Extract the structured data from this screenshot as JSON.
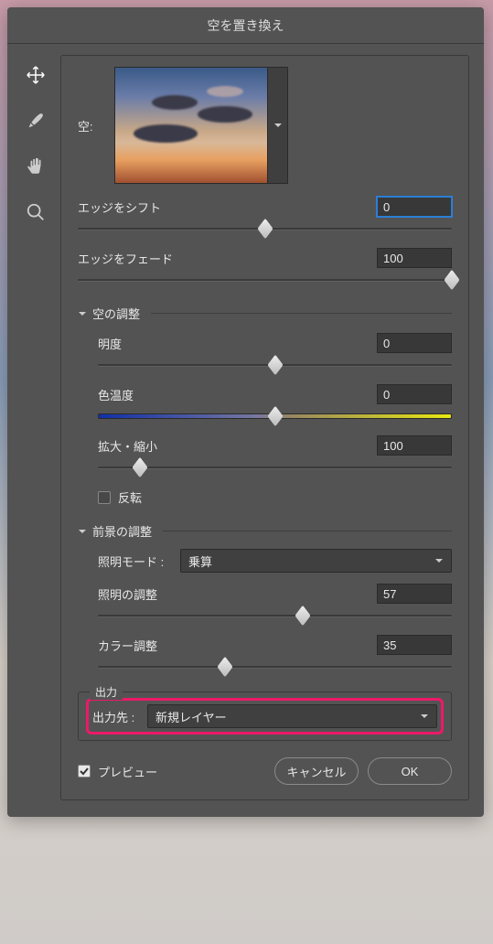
{
  "dialog": {
    "title": "空を置き換え"
  },
  "tools": {
    "move": "move-tool",
    "brush": "brush-tool",
    "hand": "hand-tool",
    "zoom": "zoom-tool"
  },
  "sky": {
    "label": "空:"
  },
  "edge_shift": {
    "label": "エッジをシフト",
    "value": "0",
    "pos": 50
  },
  "edge_fade": {
    "label": "エッジをフェード",
    "value": "100",
    "pos": 100
  },
  "sections": {
    "sky_adjust": "空の調整",
    "foreground_adjust": "前景の調整"
  },
  "brightness": {
    "label": "明度",
    "value": "0",
    "pos": 50
  },
  "color_temp": {
    "label": "色温度",
    "value": "0",
    "pos": 50
  },
  "scale": {
    "label": "拡大・縮小",
    "value": "100",
    "pos": 12
  },
  "flip": {
    "label": "反転",
    "checked": false
  },
  "lighting_mode": {
    "label": "照明モード :",
    "value": "乗算"
  },
  "lighting_adjust": {
    "label": "照明の調整",
    "value": "57",
    "pos": 58
  },
  "color_adjust": {
    "label": "カラー調整",
    "value": "35",
    "pos": 36
  },
  "output": {
    "fieldset": "出力",
    "label": "出力先 :",
    "value": "新規レイヤー"
  },
  "preview": {
    "label": "プレビュー",
    "checked": true
  },
  "buttons": {
    "cancel": "キャンセル",
    "ok": "OK"
  }
}
